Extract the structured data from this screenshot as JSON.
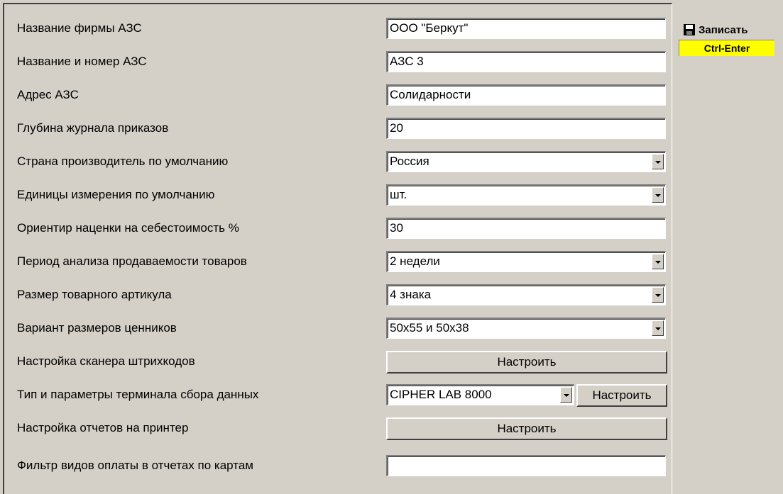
{
  "form": {
    "rows": [
      {
        "label": "Название фирмы АЗС",
        "value": "ООО \"Беркут\""
      },
      {
        "label": "Название и номер АЗС",
        "value": "АЗС 3"
      },
      {
        "label": "Адрес АЗС",
        "value": "Солидарности"
      },
      {
        "label": "Глубина журнала приказов",
        "value": "20"
      },
      {
        "label": "Страна производитель по умолчанию",
        "value": "Россия"
      },
      {
        "label": "Единицы измерения по умолчанию",
        "value": "шт."
      },
      {
        "label": "Ориентир наценки на себестоимость %",
        "value": "30"
      },
      {
        "label": "Период анализа продаваемости товаров",
        "value": "2 недели"
      },
      {
        "label": "Размер товарного артикула",
        "value": "4 знака"
      },
      {
        "label": "Вариант размеров ценников",
        "value": "50x55 и 50x38"
      },
      {
        "label": "Настройка сканера штрихкодов",
        "button": "Настроить"
      },
      {
        "label": "Тип и параметры терминала сбора данных",
        "value": "CIPHER LAB 8000",
        "button": "Настроить"
      },
      {
        "label": "Настройка отчетов на принтер",
        "button": "Настроить"
      },
      {
        "label": "Фильтр видов оплаты в отчетах по картам",
        "value": ""
      }
    ]
  },
  "toolbar": {
    "save_label": "Записать",
    "save_icon": "floppy-disk-icon",
    "hotkey_label": "Ctrl-Enter",
    "hotkey_color": "#ffff00"
  }
}
